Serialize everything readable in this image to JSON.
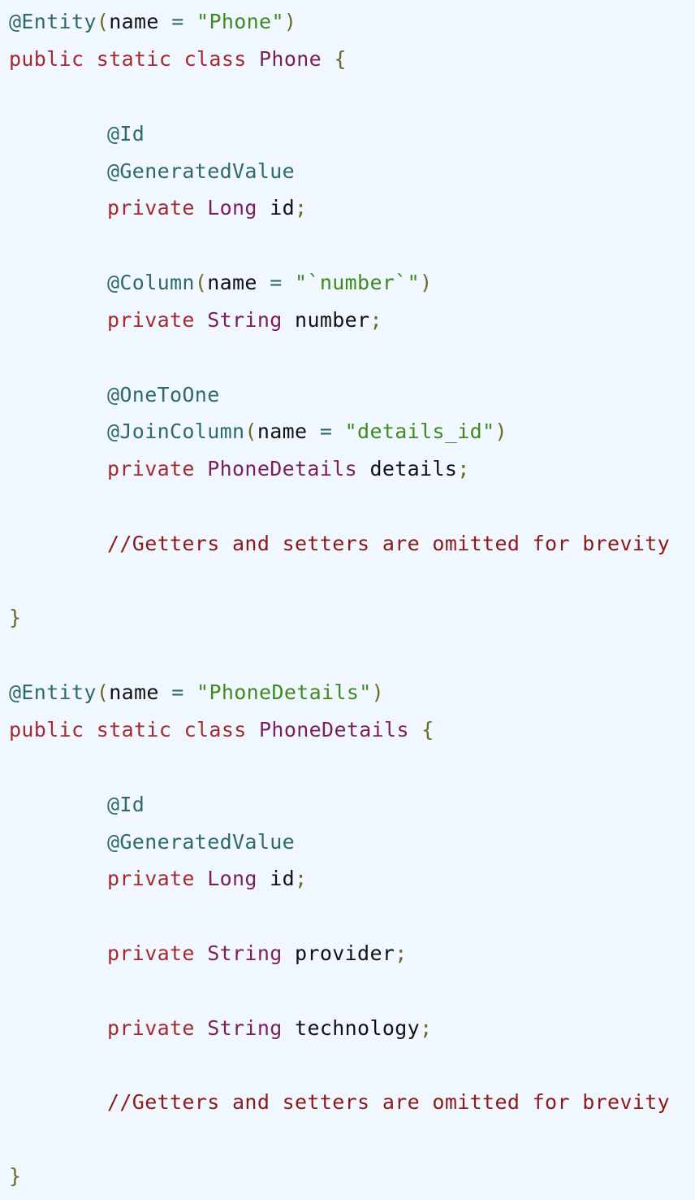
{
  "code_view": {
    "blocks": [
      {
        "entity_annotation": "@Entity",
        "entity_name_key": "name",
        "entity_name_value": "\"Phone\"",
        "class_modifiers": "public static class",
        "class_name": "Phone",
        "id_annotation": "@Id",
        "generated_annotation": "@GeneratedValue",
        "id_field": {
          "modifier": "private",
          "type": "Long",
          "name": "id"
        },
        "column_annotation": "@Column",
        "column_name_key": "name",
        "column_name_value": "\"`number`\"",
        "number_field": {
          "modifier": "private",
          "type": "String",
          "name": "number"
        },
        "one_to_one_annotation": "@OneToOne",
        "join_column_annotation": "@JoinColumn",
        "join_name_key": "name",
        "join_name_value": "\"details_id\"",
        "details_field": {
          "modifier": "private",
          "type": "PhoneDetails",
          "name": "details"
        },
        "comment": "//Getters and setters are omitted for brevity"
      },
      {
        "entity_annotation": "@Entity",
        "entity_name_key": "name",
        "entity_name_value": "\"PhoneDetails\"",
        "class_modifiers": "public static class",
        "class_name": "PhoneDetails",
        "id_annotation": "@Id",
        "generated_annotation": "@GeneratedValue",
        "id_field": {
          "modifier": "private",
          "type": "Long",
          "name": "id"
        },
        "provider_field": {
          "modifier": "private",
          "type": "String",
          "name": "provider"
        },
        "technology_field": {
          "modifier": "private",
          "type": "String",
          "name": "technology"
        },
        "comment": "//Getters and setters are omitted for brevity"
      }
    ],
    "punct": {
      "open_paren": "(",
      "close_paren": ")",
      "equals": " = ",
      "open_brace": "{",
      "close_brace": "}",
      "semicolon": ";"
    },
    "colors": {
      "background": "#f1f7fe",
      "annotation": "#2f6a6a",
      "keyword": "#a42a2f",
      "type": "#7a1f5b",
      "string": "#3f8a1f",
      "comment": "#8b1a1a",
      "punctuation": "#6b6b24",
      "identifier": "#111111"
    }
  }
}
